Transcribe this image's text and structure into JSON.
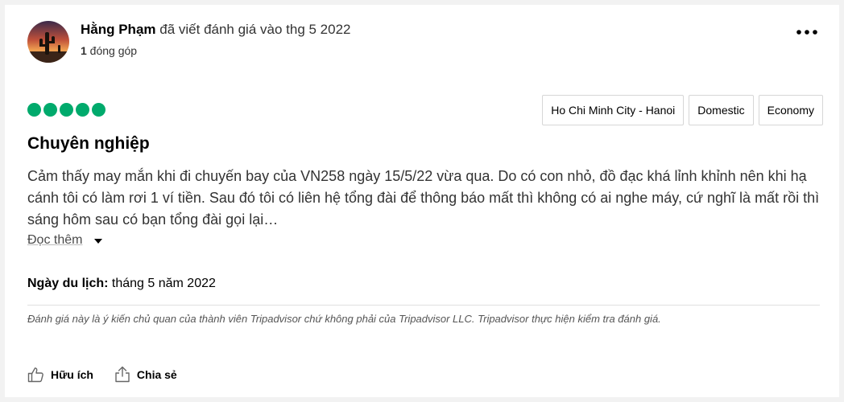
{
  "review": {
    "author": {
      "name": "Hằng Phạm",
      "action_text": " đã viết đánh giá vào thg 5 2022",
      "contributions_count": "1",
      "contributions_label": " đóng góp",
      "avatar_icon": "desert-sunset-avatar"
    },
    "more_icon": "more-horizontal-icon",
    "rating": {
      "value": 5,
      "max": 5,
      "color": "#00aa6c"
    },
    "tags": [
      "Ho Chi Minh City - Hanoi",
      "Domestic",
      "Economy"
    ],
    "title": "Chuyên nghiệp",
    "body": "Cảm thấy may mắn khi đi chuyến bay của VN258 ngày 15/5/22 vừa qua. Do có con nhỏ, đồ đạc khá lỉnh khỉnh nên khi hạ cánh tôi có làm rơi 1 ví tiền. Sau đó tôi có liên hệ tổng đài để thông báo mất thì không có ai nghe máy, cứ nghĩ là mất rồi thì sáng hôm sau có bạn tổng đài gọi lại…",
    "read_more_label": "Đọc thêm",
    "travel_date": {
      "label": "Ngày du lịch:",
      "value": " tháng 5 năm 2022"
    },
    "disclaimer": "Đánh giá này là ý kiến chủ quan của thành viên Tripadvisor chứ không phải của Tripadvisor LLC. Tripadvisor thực hiện kiểm tra đánh giá.",
    "actions": {
      "helpful_label": "Hữu ích",
      "share_label": "Chia sẻ"
    }
  }
}
